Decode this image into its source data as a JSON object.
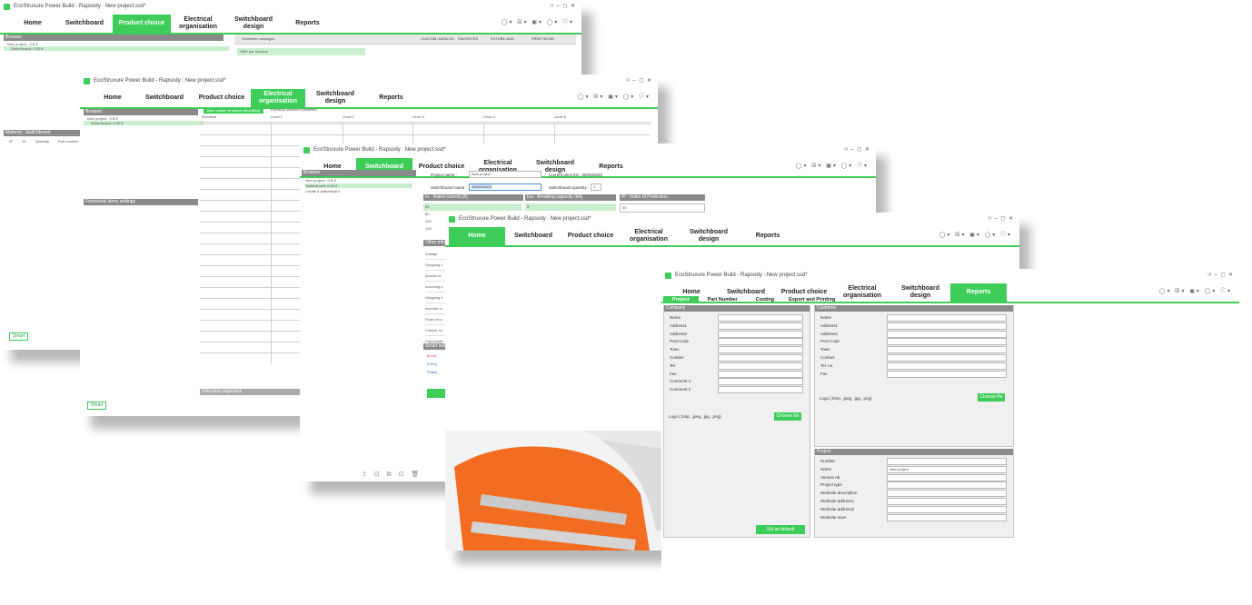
{
  "windows": {
    "w1": {
      "title": "EcoStruxure Power Build - Rapsody : New project.ssd*",
      "controls": "⌑ – ◻ ✕",
      "tabs": [
        "Home",
        "Switchboard",
        "Product choice",
        "Electrical organisation",
        "Switchboard design",
        "Reports"
      ],
      "active_tab": "Product choice",
      "tools": "◯▾ ☒▾ ▣▾ ◯▾ ⓘ▾",
      "browser_title": "Browser",
      "tree": [
        "New project : 0 B €",
        "Switchboard: 0.00 €"
      ],
      "catalogue_label": "Schneider catalogue",
      "toolbar_items": [
        "CUSTOM CATALOG",
        "FAVORITES",
        "FUTURE ADD",
        "PRINT MODE"
      ],
      "filter_label": "Offer per function",
      "material_title": "Material : Switchboard",
      "material_columns": [
        "N°",
        "M.",
        "Quantity",
        "Part number"
      ],
      "smart": "Smart"
    },
    "w2": {
      "title": "EcoStruxure Power Build - Rapsody : New project.ssd*",
      "controls": "⌑ – ◻ ✕",
      "tabs": [
        "Home",
        "Switchboard",
        "Product choice",
        "Electrical organisation",
        "Switchboard design",
        "Reports"
      ],
      "active_tab": "Electrical organisation",
      "tools": "◯▾ ☒▾ ▣▾ ◯▾ ⓘ▾",
      "browser_title": "Browser",
      "tree": [
        "New project : 0 B €",
        "Switchboard: 0.00 €"
      ],
      "view_options": [
        "Main outline structure (simplified)",
        "Electrical structure (detailed)"
      ],
      "grid_columns": [
        "Electrical",
        "Level 1",
        "Level 2",
        "Level 3",
        "Level 4",
        "Level 5"
      ],
      "functional_title": "Functional items settings",
      "selection_title": "Selection properties",
      "smart": "Smart"
    },
    "w3": {
      "title": "EcoStruxure Power Build - Rapsody : New project.ssd*",
      "controls": "⌑ – ◻ ✕",
      "tabs": [
        "Home",
        "Switchboard",
        "Product choice",
        "Electrical organisation",
        "Switchboard design",
        "Reports"
      ],
      "active_tab": "Switchboard",
      "tools": "◯▾ ☒▾ ▣▾ ◯▾ ⓘ▾",
      "browser_title": "Browser",
      "tree": [
        "New project : 0 B €",
        "Switchboard: 0.00 €",
        "Create a switchboard"
      ],
      "project_name_label": "Project name :",
      "project_name_value": "New project",
      "price_list": "Current price list : 09/03/2020",
      "switchboard_name_label": "Switchboard name :",
      "switchboard_name_value": "Switchboard",
      "quantity_label": "Switchboard quantity :",
      "quantity_value": "1",
      "panel_titles": [
        "In - Rated current (A)",
        "Icu - Breaking capacity (kA)",
        "IP - Index of Protection"
      ],
      "current_values": [
        "63",
        "80",
        "100",
        "125"
      ],
      "breaking_value": "5",
      "ip_value": "30",
      "section_title": "Other info",
      "rows": [
        "Voltage",
        "Outgoing c",
        "Access to",
        "Incoming c",
        "Outgoing c",
        "Incomer m",
        "Flush mou",
        "Cubicle ou",
        "Commutati"
      ],
      "smart_title": "Smart sele",
      "smart_items": [
        "Eco-fr",
        "Energ",
        "Phase"
      ]
    },
    "w4": {
      "title": "EcoStruxure Power Build - Rapsody : New project.ssd*",
      "controls": "⌑ – ◻ ✕",
      "tabs": [
        "Home",
        "Switchboard",
        "Product choice",
        "Electrical organisation",
        "Switchboard design",
        "Reports"
      ],
      "active_tab": "Home",
      "tools": "◯▾ ☒▾ ▣▾ ◯▾ ⓘ▾"
    },
    "w5": {
      "title": "EcoStruxure Power Build - Rapsody : New project.ssd*",
      "controls": "⌑ – ◻ ✕",
      "tabs": [
        "Home",
        "Switchboard",
        "Product choice",
        "Electrical organisation",
        "Switchboard design",
        "Reports"
      ],
      "active_tab": "Reports",
      "tools": "◯▾ ☒▾ ▣▾ ◯▾ ⓘ▾",
      "subtabs": [
        "Project",
        "Part Number",
        "Costing",
        "Export and Printing"
      ],
      "company_title": "Company",
      "company_fields": [
        "Name",
        "Address1",
        "Address2",
        "Post Code",
        "Town",
        "Contact",
        "Tel.",
        "Fax",
        "Comment 1",
        "Comment 2"
      ],
      "logo_label_company": "Logo (.bmp, .jpeg, .jpg, .png)",
      "choose_file": "Choose file",
      "set_default": "Set as default",
      "customer_title": "Customer",
      "customer_fields": [
        "Name",
        "Address1",
        "Address2",
        "Post Code",
        "Town",
        "Contact",
        "Tel. no.",
        "Fax"
      ],
      "logo_label_customer": "Logo (.bmp, .jpeg, .jpg, .png)",
      "project_title": "Project",
      "project_fields": [
        "Number",
        "Name",
        "Version nb.",
        "Project type",
        "Worksite description",
        "Worksite address1",
        "Worksite address2",
        "Worksite town"
      ],
      "project_name_value": "New project"
    }
  },
  "colors": {
    "accent": "#3dcd58",
    "header_gray": "#8a8a8a",
    "orange": "#f26d21"
  }
}
